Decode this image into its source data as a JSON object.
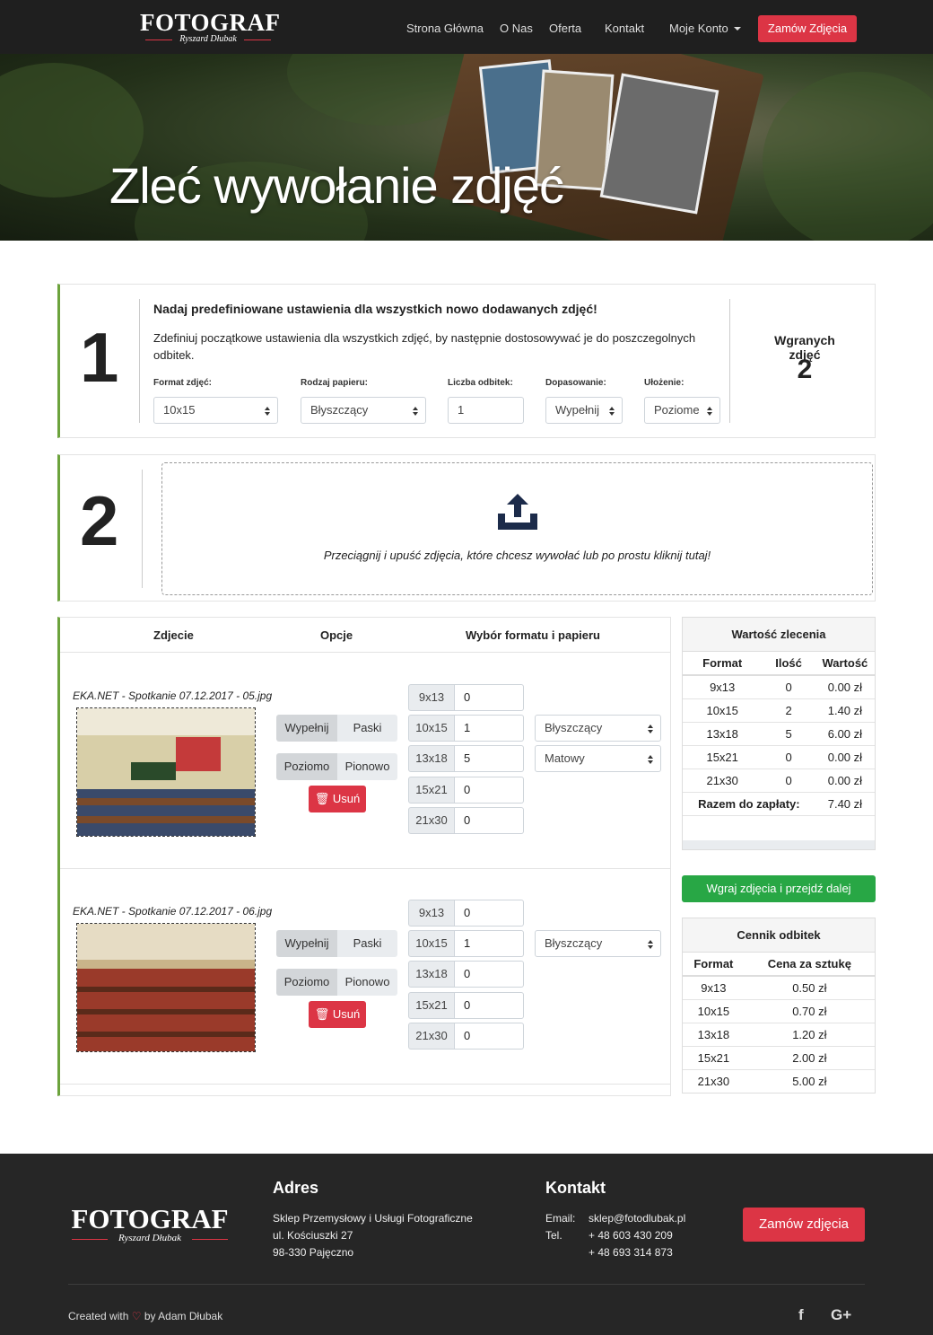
{
  "nav": {
    "logo_main": "FOTOGRAF",
    "logo_sub": "Ryszard Dłubak",
    "links": [
      "Strona Główna",
      "O Nas",
      "Oferta",
      "Kontakt",
      "Moje Konto"
    ],
    "order_button": "Zamów Zdjęcia"
  },
  "hero": {
    "title": "Zleć wywołanie zdjęć"
  },
  "step1": {
    "number": "1",
    "title": "Nadaj predefiniowane ustawienia dla wszystkich nowo dodawanych zdjęć!",
    "description": "Zdefiniuj początkowe ustawienia dla wszystkich zdjęć, by następnie dostosowywać je do poszczegolnych odbitek.",
    "fields": [
      {
        "label": "Format zdjęć:",
        "value": "10x15"
      },
      {
        "label": "Rodzaj papieru:",
        "value": "Błyszczący"
      },
      {
        "label": "Liczba odbitek:",
        "value": "1"
      },
      {
        "label": "Dopasowanie:",
        "value": "Wypełnij"
      },
      {
        "label": "Ułożenie:",
        "value": "Poziome"
      }
    ],
    "uploaded_label": "Wgranych zdjęć",
    "uploaded_count": "2"
  },
  "step2": {
    "number": "2",
    "dropzone_text": "Przeciągnij i upuść zdjęcia, które chcesz wywołać lub po prostu kliknij tutaj!"
  },
  "photos_table": {
    "headers": [
      "Zdjecie",
      "Opcje",
      "Wybór formatu i papieru"
    ],
    "rows": [
      {
        "filename": "EKA.NET - Spotkanie 07.12.2017 - 05.jpg",
        "fit_options": [
          "Wypełnij",
          "Paski"
        ],
        "orient_options": [
          "Poziomo",
          "Pionowo"
        ],
        "delete_label": "Usuń",
        "formats": [
          {
            "label": "9x13",
            "qty": "0"
          },
          {
            "label": "10x15",
            "qty": "1"
          },
          {
            "label": "13x18",
            "qty": "5"
          },
          {
            "label": "15x21",
            "qty": "0"
          },
          {
            "label": "21x30",
            "qty": "0"
          }
        ],
        "papers": [
          "Błyszczący",
          "Matowy"
        ]
      },
      {
        "filename": "EKA.NET - Spotkanie 07.12.2017 - 06.jpg",
        "fit_options": [
          "Wypełnij",
          "Paski"
        ],
        "orient_options": [
          "Poziomo",
          "Pionowo"
        ],
        "delete_label": "Usuń",
        "formats": [
          {
            "label": "9x13",
            "qty": "0"
          },
          {
            "label": "10x15",
            "qty": "1"
          },
          {
            "label": "13x18",
            "qty": "0"
          },
          {
            "label": "15x21",
            "qty": "0"
          },
          {
            "label": "21x30",
            "qty": "0"
          }
        ],
        "papers": [
          "Błyszczący"
        ]
      }
    ]
  },
  "order_value": {
    "title": "Wartość zlecenia",
    "headers": [
      "Format",
      "Ilość",
      "Wartość"
    ],
    "rows": [
      [
        "9x13",
        "0",
        "0.00 zł"
      ],
      [
        "10x15",
        "2",
        "1.40 zł"
      ],
      [
        "13x18",
        "5",
        "6.00 zł"
      ],
      [
        "15x21",
        "0",
        "0.00 zł"
      ],
      [
        "21x30",
        "0",
        "0.00 zł"
      ]
    ],
    "total_label": "Razem do zapłaty:",
    "total_value": "7.40 zł",
    "next_button": "Wgraj zdjęcia i przejdź dalej"
  },
  "price_list": {
    "title": "Cennik odbitek",
    "headers": [
      "Format",
      "Cena za sztukę"
    ],
    "rows": [
      [
        "9x13",
        "0.50 zł"
      ],
      [
        "10x15",
        "0.70 zł"
      ],
      [
        "13x18",
        "1.20 zł"
      ],
      [
        "15x21",
        "2.00 zł"
      ],
      [
        "21x30",
        "5.00 zł"
      ]
    ]
  },
  "footer": {
    "logo_main": "FOTOGRAF",
    "logo_sub": "Ryszard Dłubak",
    "address_title": "Adres",
    "address_lines": [
      "Sklep Przemysłowy i Usługi Fotograficzne",
      "ul. Kościuszki 27",
      "98-330 Pajęczno"
    ],
    "contact_title": "Kontakt",
    "email_label": "Email:",
    "email": "sklep@fotodlubak.pl",
    "tel_label": "Tel.",
    "phones": [
      "+ 48 603 430 209",
      "+ 48 693 314 873"
    ],
    "order_button": "Zamów zdjęcia",
    "credit_pre": "Created with",
    "credit_post": "by Adam Dłubak",
    "social": [
      "f",
      "G+"
    ]
  },
  "colors": {
    "accent_red": "#dc3545",
    "green": "#28a745",
    "step_border": "#6ca33c",
    "nav_bg": "#1f1f1f"
  }
}
